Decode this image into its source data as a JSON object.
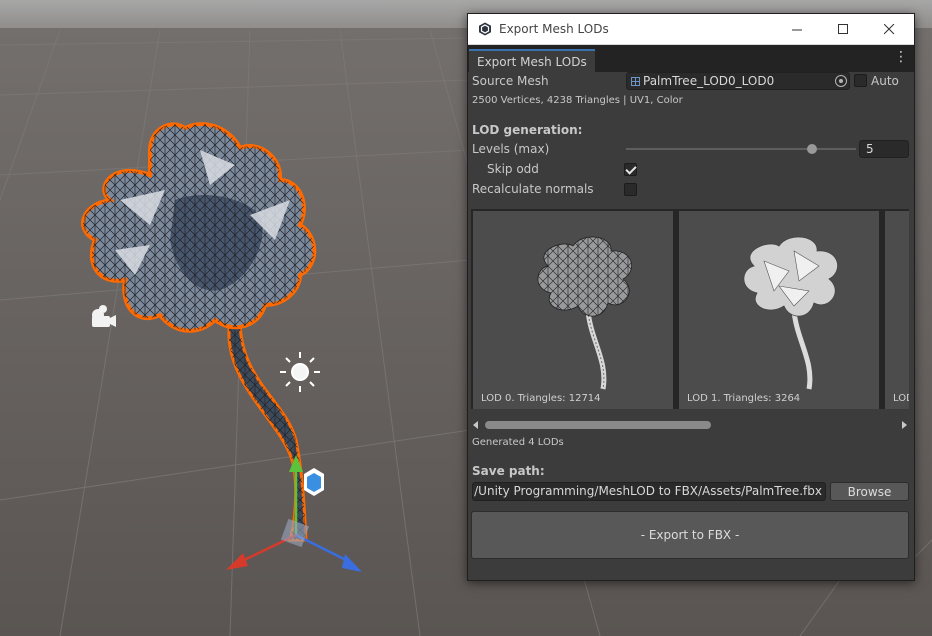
{
  "window": {
    "title": "Export Mesh LODs",
    "tab_label": "Export Mesh LODs"
  },
  "source": {
    "label": "Source Mesh",
    "mesh_name": "PalmTree_LOD0_LOD0",
    "auto_label": "Auto",
    "auto_checked": false,
    "info": "2500 Vertices, 4238 Triangles | UV1, Color"
  },
  "lod_generation": {
    "heading": "LOD generation:",
    "levels_label": "Levels (max)",
    "levels_value": "5",
    "levels_slider_fraction": 0.81,
    "skip_odd_label": "Skip odd",
    "skip_odd_checked": true,
    "recalc_normals_label": "Recalculate normals",
    "recalc_normals_checked": false
  },
  "lods": [
    {
      "caption": "LOD 0. Triangles: 12714"
    },
    {
      "caption": "LOD 1. Triangles: 3264"
    },
    {
      "caption": "LOD"
    }
  ],
  "generated_text": "Generated 4 LODs",
  "save": {
    "label": "Save path:",
    "path": "oud/Unity Programming/MeshLOD to FBX/Assets/PalmTree.fbx",
    "browse_label": "Browse"
  },
  "export_label": "- Export to FBX -",
  "colors": {
    "editor_bg": "#3c3c3c",
    "selection_outline": "#ff6a00",
    "axis_x": "#d63a2a",
    "axis_y": "#5bc43a",
    "axis_z": "#3a6ee0"
  }
}
